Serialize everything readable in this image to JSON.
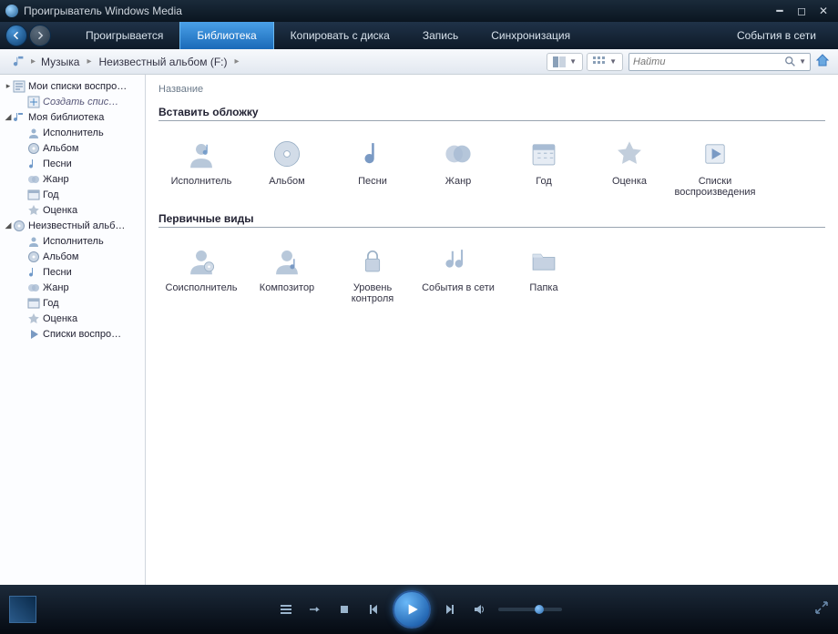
{
  "window": {
    "title": "Проигрыватель Windows Media"
  },
  "tabs": [
    {
      "label": "Проигрывается"
    },
    {
      "label": "Библиотека",
      "active": true
    },
    {
      "label": "Копировать с диска"
    },
    {
      "label": "Запись"
    },
    {
      "label": "Синхронизация"
    },
    {
      "label": "События в сети"
    }
  ],
  "breadcrumb": {
    "root": "Музыка",
    "node": "Неизвестный альбом (F:)"
  },
  "search": {
    "placeholder": "Найти"
  },
  "sidebar": {
    "playlists": {
      "label": "Мои списки воспро…",
      "create": "Создать спис…"
    },
    "library": {
      "label": "Моя библиотека",
      "items": [
        {
          "label": "Исполнитель"
        },
        {
          "label": "Альбом"
        },
        {
          "label": "Песни"
        },
        {
          "label": "Жанр"
        },
        {
          "label": "Год"
        },
        {
          "label": "Оценка"
        }
      ]
    },
    "album": {
      "label": "Неизвестный альб…",
      "items": [
        {
          "label": "Исполнитель"
        },
        {
          "label": "Альбом"
        },
        {
          "label": "Песни"
        },
        {
          "label": "Жанр"
        },
        {
          "label": "Год"
        },
        {
          "label": "Оценка"
        },
        {
          "label": "Списки воспро…"
        }
      ]
    }
  },
  "content": {
    "column_header": "Название",
    "section1": {
      "title": "Вставить обложку",
      "items": [
        {
          "label": "Исполнитель",
          "icon": "artist"
        },
        {
          "label": "Альбом",
          "icon": "album"
        },
        {
          "label": "Песни",
          "icon": "songs"
        },
        {
          "label": "Жанр",
          "icon": "genre"
        },
        {
          "label": "Год",
          "icon": "year"
        },
        {
          "label": "Оценка",
          "icon": "rating"
        },
        {
          "label": "Списки воспроизведения",
          "icon": "playlists"
        }
      ]
    },
    "section2": {
      "title": "Первичные виды",
      "items": [
        {
          "label": "Соисполнитель",
          "icon": "coartist"
        },
        {
          "label": "Композитор",
          "icon": "composer"
        },
        {
          "label": "Уровень контроля",
          "icon": "control"
        },
        {
          "label": "События в сети",
          "icon": "online"
        },
        {
          "label": "Папка",
          "icon": "folder"
        }
      ]
    }
  }
}
